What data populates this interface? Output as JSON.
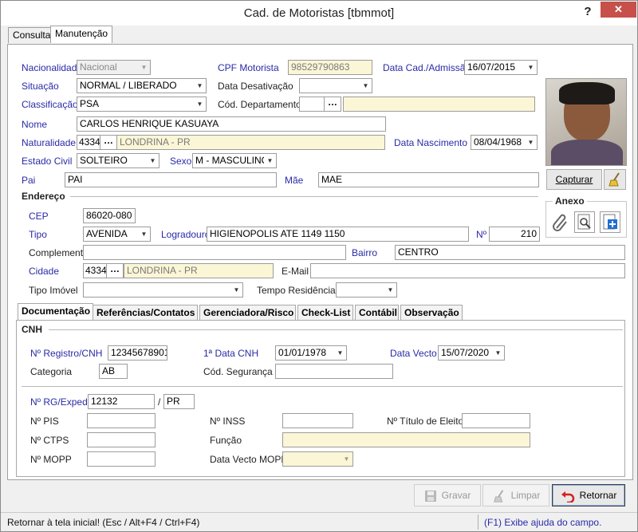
{
  "window": {
    "title": "Cad. de Motoristas [tbmmot]",
    "help": "?",
    "close": "✕"
  },
  "tabs": [
    "Consulta",
    "Manutenção"
  ],
  "form": {
    "nacionalidade": {
      "label": "Nacionalidade",
      "value": "Nacional"
    },
    "cpf": {
      "label": "CPF Motorista",
      "value": "98529790863"
    },
    "data_cad": {
      "label": "Data Cad./Admissão",
      "value": "16/07/2015"
    },
    "situacao": {
      "label": "Situação",
      "value": "NORMAL / LIBERADO"
    },
    "data_desativacao": {
      "label": "Data Desativação",
      "value": ""
    },
    "classificacao": {
      "label": "Classificação",
      "value": "PSA"
    },
    "cod_departamento": {
      "label": "Cód. Departamento",
      "value": ""
    },
    "nome": {
      "label": "Nome",
      "value": "CARLOS HENRIQUE KASUAYA"
    },
    "naturalidade": {
      "label": "Naturalidade",
      "code": "4334",
      "city": "LONDRINA - PR"
    },
    "data_nascimento": {
      "label": "Data Nascimento",
      "value": "08/04/1968"
    },
    "estado_civil": {
      "label": "Estado Civil",
      "value": "SOLTEIRO"
    },
    "sexo": {
      "label": "Sexo",
      "value": "M - MASCULINO"
    },
    "pai": {
      "label": "Pai",
      "value": "PAI"
    },
    "mae": {
      "label": "Mãe",
      "value": "MAE"
    }
  },
  "photo": {
    "capture_label": "Capturar"
  },
  "endereco": {
    "title": "Endereço",
    "cep": {
      "label": "CEP",
      "value": "86020-080"
    },
    "tipo": {
      "label": "Tipo",
      "value": "AVENIDA"
    },
    "logradouro": {
      "label": "Logradouro",
      "value": "HIGIENOPOLIS  ATE 1149 1150"
    },
    "numero": {
      "label": "Nº",
      "value": "210"
    },
    "complemento": {
      "label": "Complemento",
      "value": ""
    },
    "bairro": {
      "label": "Bairro",
      "value": "CENTRO"
    },
    "cidade": {
      "label": "Cidade",
      "code": "4334",
      "city": "LONDRINA - PR"
    },
    "email": {
      "label": "E-Mail",
      "value": ""
    },
    "tipo_imovel": {
      "label": "Tipo Imóvel",
      "value": ""
    },
    "tempo_residencia": {
      "label": "Tempo Residência",
      "value": ""
    }
  },
  "anexo": {
    "title": "Anexo"
  },
  "subtabs": [
    "Documentação",
    "Referências/Contatos",
    "Gerenciadora/Risco",
    "Check-List",
    "Contábil",
    "Observação"
  ],
  "doc": {
    "cnh_title": "CNH",
    "registro": {
      "label": "Nº Registro/CNH",
      "value": "12345678901"
    },
    "primeira_cnh": {
      "label": "1ª Data CNH",
      "value": "01/01/1978"
    },
    "data_vecto": {
      "label": "Data Vecto",
      "value": "15/07/2020"
    },
    "categoria": {
      "label": "Categoria",
      "value": "AB"
    },
    "cod_seguranca": {
      "label": "Cód. Segurança",
      "value": ""
    },
    "rg": {
      "label": "Nº RG/Exped.",
      "value": "12132",
      "sep": "/",
      "uf": "PR"
    },
    "pis": {
      "label": "Nº PIS",
      "value": ""
    },
    "inss": {
      "label": "Nº INSS",
      "value": ""
    },
    "titulo": {
      "label": "Nº Título de Eleitor",
      "value": ""
    },
    "ctps": {
      "label": "Nº CTPS",
      "value": ""
    },
    "funcao": {
      "label": "Função",
      "value": ""
    },
    "mopp": {
      "label": "Nº MOPP",
      "value": ""
    },
    "data_mopp": {
      "label": "Data Vecto MOPP",
      "value": ""
    }
  },
  "buttons": {
    "gravar": "Gravar",
    "limpar": "Limpar",
    "retornar": "Retornar"
  },
  "status": {
    "left": "Retornar à tela inicial! (Esc / Alt+F4 / Ctrl+F4)",
    "right": "(F1) Exibe ajuda do campo."
  }
}
